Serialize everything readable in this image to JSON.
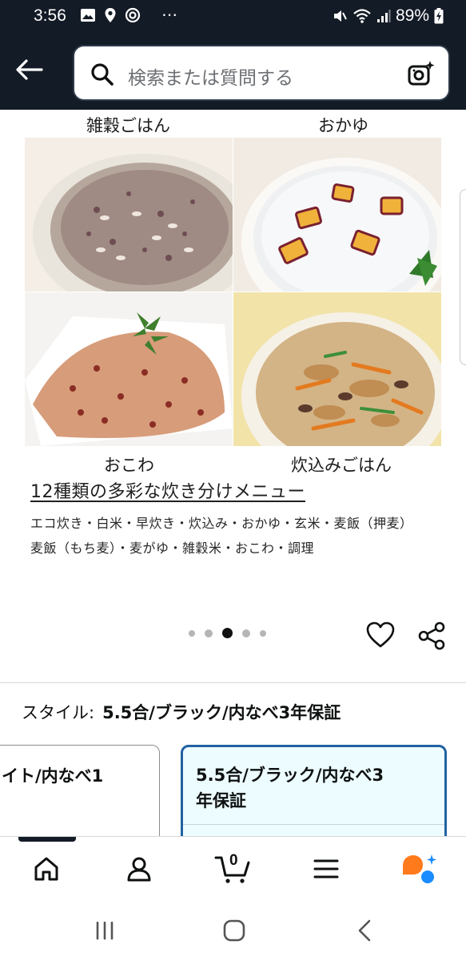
{
  "status_bar": {
    "time": "3:56",
    "more": "⋯",
    "battery_pct": "89%"
  },
  "search": {
    "placeholder": "検索または質問する"
  },
  "gallery": {
    "captions": {
      "top_left": "雑穀ごはん",
      "top_right": "おかゆ",
      "bottom_left": "おこわ",
      "bottom_right": "炊込みごはん"
    },
    "title": "12種類の多彩な炊き分けメニュー",
    "menu_line1": "エコ炊き・白米・早炊き・炊込み・おかゆ・玄米・麦飯（押麦）",
    "menu_line2": "麦飯（もち麦）・麦がゆ・雑穀米・おこわ・調理",
    "pager": {
      "count": 5,
      "active_index": 2
    }
  },
  "style": {
    "label": "スタイル:",
    "value": "5.5合/ブラック/内なべ3年保証",
    "options": [
      {
        "label": "ワイト/内なべ1",
        "selected": false
      },
      {
        "label_line1": "5.5合/ブラック/内なべ3",
        "label_line2": "年保証",
        "selected": true
      }
    ]
  },
  "tab_bar": {
    "items": [
      "home-icon",
      "account-icon",
      "cart-icon",
      "menu-icon",
      "rufus-icon"
    ],
    "cart_count": "0",
    "active_index": 0
  },
  "colors": {
    "header_bg": "#131b26",
    "selected_border": "#2162a1",
    "selected_bg": "#edfdff",
    "rufus_orange": "#ff7a1a",
    "rufus_blue": "#1a8cff"
  }
}
